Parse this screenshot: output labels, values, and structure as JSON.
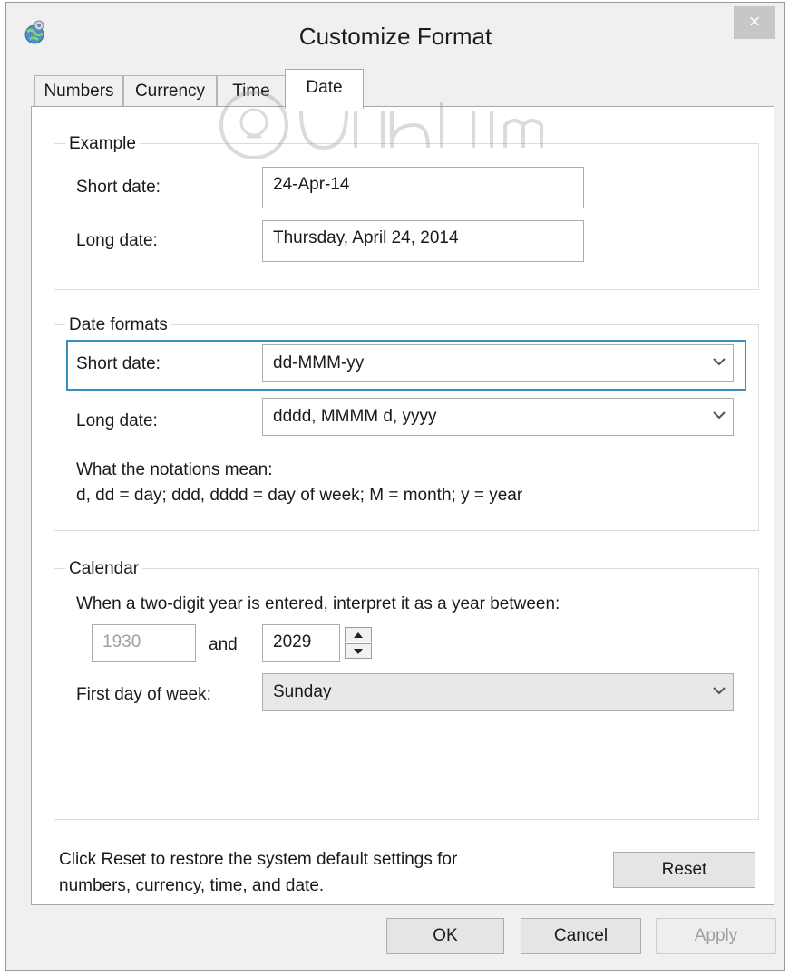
{
  "window": {
    "title": "Customize Format",
    "close_glyph": "×",
    "app_icon": "globe-settings-icon"
  },
  "tabs": [
    {
      "label": "Numbers",
      "active": false
    },
    {
      "label": "Currency",
      "active": false
    },
    {
      "label": "Time",
      "active": false
    },
    {
      "label": "Date",
      "active": true
    }
  ],
  "example": {
    "legend": "Example",
    "short_label": "Short date:",
    "short_value": "24-Apr-14",
    "long_label": "Long date:",
    "long_value": "Thursday, April 24, 2014"
  },
  "date_formats": {
    "legend": "Date formats",
    "short_label": "Short date:",
    "short_value": "dd-MMM-yy",
    "long_label": "Long date:",
    "long_value": "dddd, MMMM d, yyyy",
    "notation_title": "What the notations mean:",
    "notation_text": "d, dd = day;  ddd, dddd = day of week;  M = month;  y = year"
  },
  "calendar": {
    "legend": "Calendar",
    "two_digit_text": "When a two-digit year is entered, interpret it as a year between:",
    "start_year": "1930",
    "and_label": "and",
    "end_year": "2029",
    "first_day_label": "First day of week:",
    "first_day_value": "Sunday"
  },
  "reset": {
    "text_line1": "Click Reset to restore the system default settings for",
    "text_line2": "numbers, currency, time, and date.",
    "button_label": "Reset"
  },
  "footer": {
    "ok_label": "OK",
    "cancel_label": "Cancel",
    "apply_label": "Apply"
  },
  "colors": {
    "focus_border": "#3c8ebf",
    "disabled_text": "#a0a0a0"
  }
}
